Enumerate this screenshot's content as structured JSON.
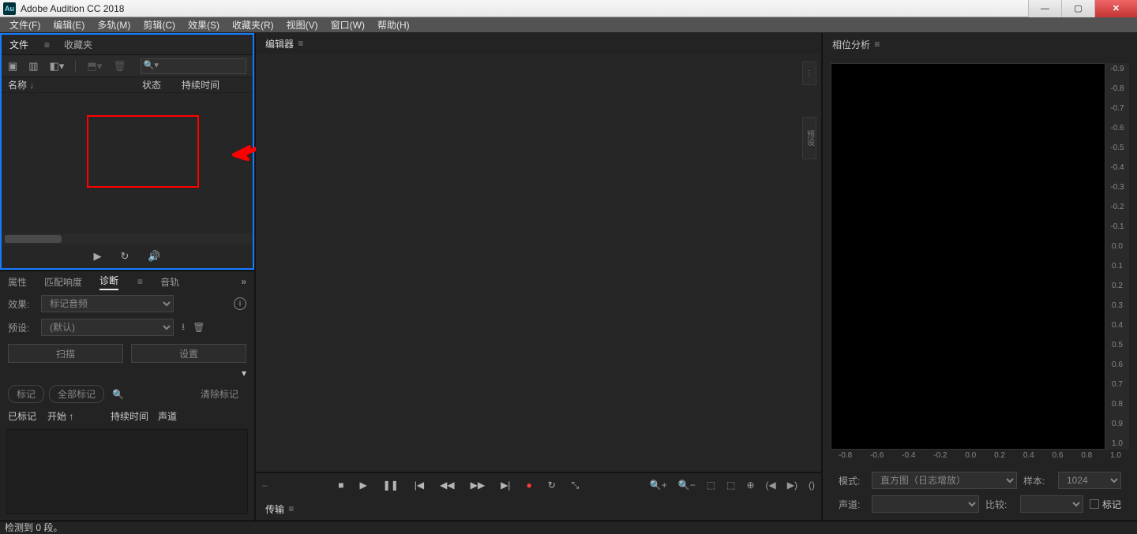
{
  "titlebar": {
    "app_title": "Adobe Audition CC 2018",
    "logo_text": "Au"
  },
  "menu": {
    "file": "文件(F)",
    "edit": "编辑(E)",
    "multitrack": "多轨(M)",
    "clip": "剪辑(C)",
    "effects": "效果(S)",
    "favorites": "收藏夹(R)",
    "view": "视图(V)",
    "window": "窗口(W)",
    "help": "帮助(H)"
  },
  "files_panel": {
    "tab_files": "文件",
    "tab_favorites": "收藏夹",
    "search_placeholder": "",
    "col_name": "名称",
    "col_status": "状态",
    "col_duration": "持续时间"
  },
  "diag_panel": {
    "tab_properties": "属性",
    "tab_match": "匹配响度",
    "tab_diag": "诊断",
    "tab_rec": "音轨",
    "lbl_effect": "效果:",
    "sel_effect": "标记音频",
    "lbl_preset": "预设:",
    "sel_preset": "(默认)",
    "btn_scan": "扫描",
    "btn_settings": "设置",
    "pill_mark": "标记",
    "pill_markall": "全部标记",
    "pill_clear": "清除标记",
    "col_marked": "已标记",
    "col_start": "开始",
    "col_dur": "持续时间",
    "col_channel": "声道"
  },
  "editor": {
    "title": "编辑器",
    "sidepill_preset": "预设"
  },
  "transport_panel": {
    "title": "传输"
  },
  "phase": {
    "title": "相位分析",
    "yticks": [
      "-0.9",
      "-0.8",
      "-0.7",
      "-0.6",
      "-0.5",
      "-0.4",
      "-0.3",
      "-0.2",
      "-0.1",
      "0.0",
      "0.1",
      "0.2",
      "0.3",
      "0.4",
      "0.5",
      "0.6",
      "0.7",
      "0.8",
      "0.9",
      "1.0"
    ],
    "xticks": [
      "-0.8",
      "-0.6",
      "-0.4",
      "-0.2",
      "0.0",
      "0.2",
      "0.4",
      "0.6",
      "0.8",
      "1.0"
    ],
    "lbl_mode": "模式:",
    "sel_mode": "直方图（日志增放）",
    "lbl_sample": "样本:",
    "sel_sample": "1024",
    "lbl_channel": "声道:",
    "lbl_compare": "比较:",
    "chk_label": "标记"
  },
  "statusbar": {
    "text": "检测到 0 段。"
  }
}
